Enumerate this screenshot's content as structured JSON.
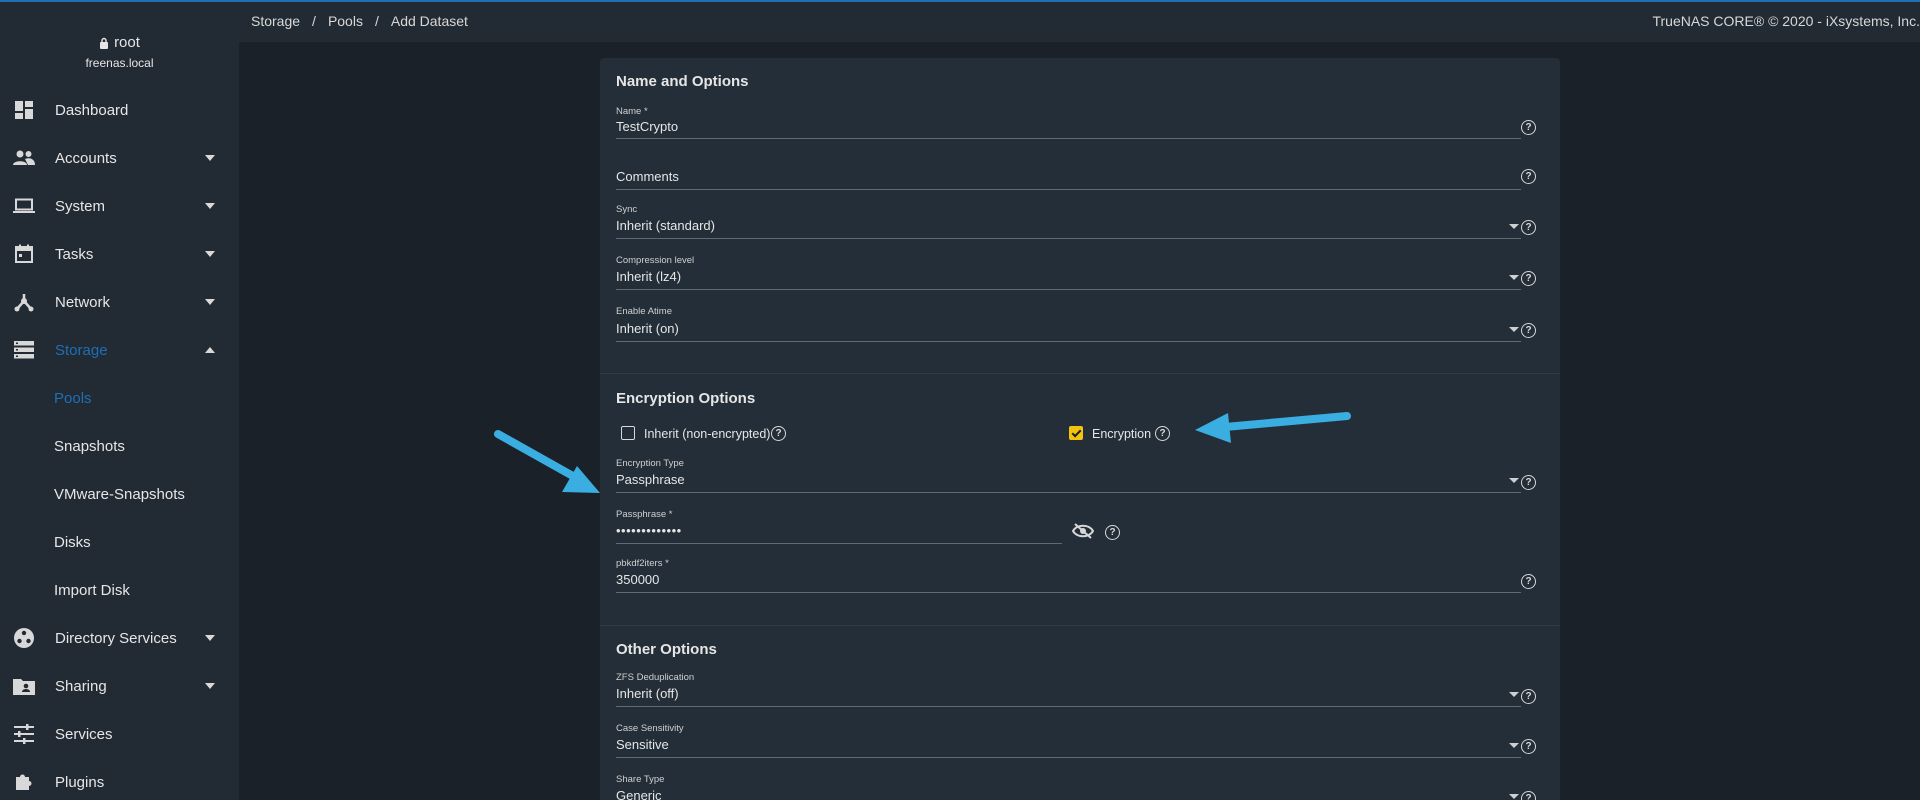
{
  "user": {
    "name": "root",
    "host": "freenas.local"
  },
  "nav": [
    {
      "label": "Dashboard",
      "icon": "dashboard-icon"
    },
    {
      "label": "Accounts",
      "icon": "accounts-icon"
    },
    {
      "label": "System",
      "icon": "laptop-icon"
    },
    {
      "label": "Tasks",
      "icon": "calendar-icon"
    },
    {
      "label": "Network",
      "icon": "network-icon"
    },
    {
      "label": "Storage",
      "icon": "storage-icon"
    },
    {
      "label": "Directory Services",
      "icon": "directory-icon"
    },
    {
      "label": "Sharing",
      "icon": "folder-share-icon"
    },
    {
      "label": "Services",
      "icon": "tune-icon"
    },
    {
      "label": "Plugins",
      "icon": "puzzle-icon"
    }
  ],
  "storage_sub": [
    "Pools",
    "Snapshots",
    "VMware-Snapshots",
    "Disks",
    "Import Disk"
  ],
  "breadcrumb": [
    "Storage",
    "Pools",
    "Add Dataset"
  ],
  "brand": "TrueNAS CORE® © 2020 - iXsystems, Inc.",
  "sections": {
    "name_options": "Name and Options",
    "encryption": "Encryption Options",
    "other": "Other Options"
  },
  "fields": {
    "name": {
      "label": "Name *",
      "value": "TestCrypto"
    },
    "comments": {
      "label": "",
      "placeholder": "Comments"
    },
    "sync": {
      "label": "Sync",
      "value": "Inherit (standard)"
    },
    "compression": {
      "label": "Compression level",
      "value": "Inherit (lz4)"
    },
    "atime": {
      "label": "Enable Atime",
      "value": "Inherit (on)"
    },
    "enc_type": {
      "label": "Encryption Type",
      "value": "Passphrase"
    },
    "passphrase": {
      "label": "Passphrase *",
      "value": "•••••••••••••"
    },
    "pbkdf2": {
      "label": "pbkdf2iters *",
      "value": "350000"
    },
    "dedup": {
      "label": "ZFS Deduplication",
      "value": "Inherit (off)"
    },
    "case": {
      "label": "Case Sensitivity",
      "value": "Sensitive"
    },
    "share": {
      "label": "Share Type",
      "value": "Generic"
    }
  },
  "checkboxes": {
    "inherit": {
      "label": "Inherit (non-encrypted)",
      "checked": false
    },
    "encryption": {
      "label": "Encryption",
      "checked": true
    }
  },
  "colors": {
    "accent": "#1f6fb5",
    "checkbox_checked": "#f2c40f",
    "arrow": "#3aaee0"
  }
}
